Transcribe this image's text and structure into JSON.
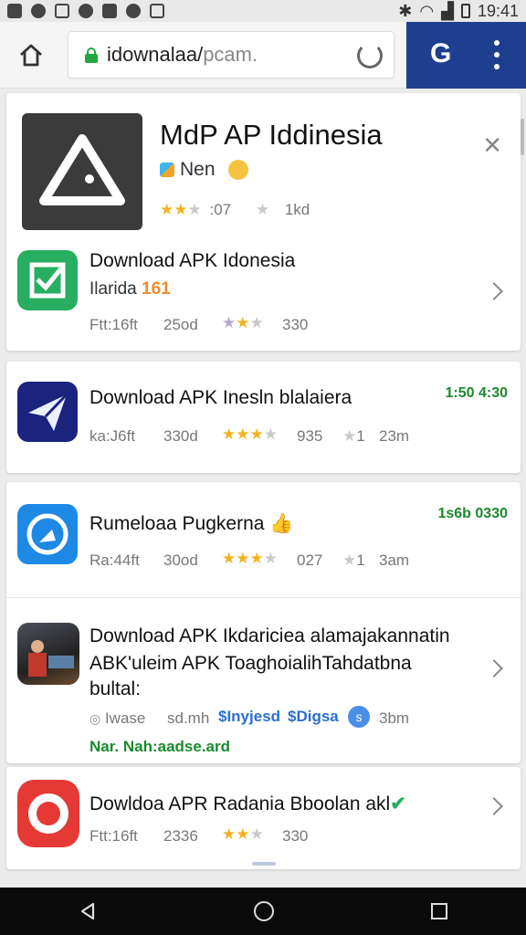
{
  "status_bar": {
    "time": "19:41"
  },
  "browser": {
    "url_main": "idownalaa/",
    "url_dim": "pcam.",
    "menu_icon": "more-vert-icon"
  },
  "featured": {
    "title": "MdP AP Iddinesia",
    "sub_label": "Nen",
    "rating_text": ":07",
    "count_text": "1kd"
  },
  "apps": [
    {
      "title": "Download APK Idonesia",
      "line2": "Ilarida",
      "line2_badge": "161",
      "meta1": "Ftt:16ft",
      "meta2": "25od",
      "count": "330"
    },
    {
      "title": "Download APK Inesln blalaiera",
      "time": "1:50 4:30",
      "meta1": "ka:J6ft",
      "meta2": "330d",
      "rating": "935",
      "extra": "1",
      "extra2": "23m"
    },
    {
      "title": "Rumeloaa Pugkerna",
      "time": "1s6b 0330",
      "meta1": "Ra:44ft",
      "meta2": "30od",
      "rating": "027",
      "extra": "1",
      "extra2": "3am"
    },
    {
      "title": "Download APK Ikdariciea alamajakannatin",
      "title2": "ABK'uleim APK ToaghoialihTahdatbna",
      "title3": "bultal:",
      "meta1": "Iwase",
      "meta2": "sd.mh",
      "tag1": "$Inyjesd",
      "tag2": "$Digsa",
      "badge": "s",
      "meta3": "3bm",
      "footer": "Nar. Nah:aadse.ard"
    },
    {
      "title": "Dowldoa APR Radania Bboolan akl",
      "meta1": "Ftt:16ft",
      "meta2": "2336",
      "count": "330"
    }
  ]
}
